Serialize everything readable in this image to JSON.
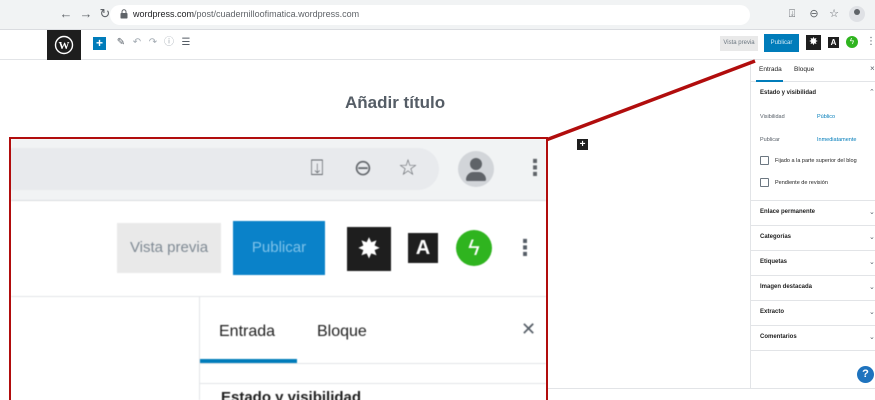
{
  "browser": {
    "url_domain": "wordpress.com",
    "url_path": "/post/cuadernilloofimatica.wordpress.com"
  },
  "toolbar": {
    "preview_label": "Vista previa",
    "publish_label": "Publicar",
    "a_label": "A"
  },
  "editor": {
    "title_placeholder": "Añadir título"
  },
  "sidebar": {
    "tabs": [
      {
        "label": "Entrada"
      },
      {
        "label": "Bloque"
      }
    ],
    "status_section": {
      "title": "Estado y visibilidad",
      "visibility_label": "Visibilidad",
      "visibility_value": "Público",
      "publish_label": "Publicar",
      "publish_value": "Inmediatamente",
      "sticky_label": "Fijado a la parte superior del blog",
      "pending_label": "Pendiente de revisión"
    },
    "sections": [
      {
        "title": "Enlace permanente"
      },
      {
        "title": "Categorías"
      },
      {
        "title": "Etiquetas"
      },
      {
        "title": "Imagen destacada"
      },
      {
        "title": "Extracto"
      },
      {
        "title": "Comentarios"
      }
    ],
    "help_label": "?"
  },
  "zoom": {
    "preview_label": "Vista previa",
    "publish_label": "Publicar",
    "a_label": "A",
    "tabs": [
      {
        "label": "Entrada"
      },
      {
        "label": "Bloque"
      }
    ],
    "section_title": "Estado y visibilidad"
  },
  "colors": {
    "accent": "#007cba",
    "callout": "#b10d0d",
    "jetpack": "#2fb41f"
  }
}
